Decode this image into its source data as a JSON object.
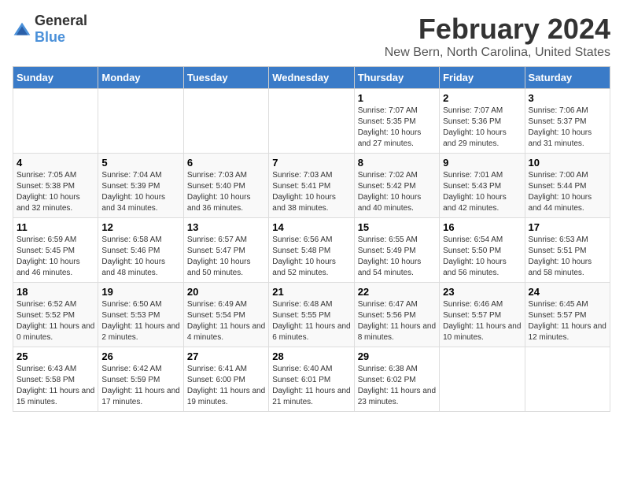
{
  "logo": {
    "text_general": "General",
    "text_blue": "Blue"
  },
  "header": {
    "title": "February 2024",
    "subtitle": "New Bern, North Carolina, United States"
  },
  "days_of_week": [
    "Sunday",
    "Monday",
    "Tuesday",
    "Wednesday",
    "Thursday",
    "Friday",
    "Saturday"
  ],
  "weeks": [
    {
      "days": [
        {
          "num": "",
          "sunrise": "",
          "sunset": "",
          "daylight": ""
        },
        {
          "num": "",
          "sunrise": "",
          "sunset": "",
          "daylight": ""
        },
        {
          "num": "",
          "sunrise": "",
          "sunset": "",
          "daylight": ""
        },
        {
          "num": "",
          "sunrise": "",
          "sunset": "",
          "daylight": ""
        },
        {
          "num": "1",
          "sunrise": "Sunrise: 7:07 AM",
          "sunset": "Sunset: 5:35 PM",
          "daylight": "Daylight: 10 hours and 27 minutes."
        },
        {
          "num": "2",
          "sunrise": "Sunrise: 7:07 AM",
          "sunset": "Sunset: 5:36 PM",
          "daylight": "Daylight: 10 hours and 29 minutes."
        },
        {
          "num": "3",
          "sunrise": "Sunrise: 7:06 AM",
          "sunset": "Sunset: 5:37 PM",
          "daylight": "Daylight: 10 hours and 31 minutes."
        }
      ]
    },
    {
      "days": [
        {
          "num": "4",
          "sunrise": "Sunrise: 7:05 AM",
          "sunset": "Sunset: 5:38 PM",
          "daylight": "Daylight: 10 hours and 32 minutes."
        },
        {
          "num": "5",
          "sunrise": "Sunrise: 7:04 AM",
          "sunset": "Sunset: 5:39 PM",
          "daylight": "Daylight: 10 hours and 34 minutes."
        },
        {
          "num": "6",
          "sunrise": "Sunrise: 7:03 AM",
          "sunset": "Sunset: 5:40 PM",
          "daylight": "Daylight: 10 hours and 36 minutes."
        },
        {
          "num": "7",
          "sunrise": "Sunrise: 7:03 AM",
          "sunset": "Sunset: 5:41 PM",
          "daylight": "Daylight: 10 hours and 38 minutes."
        },
        {
          "num": "8",
          "sunrise": "Sunrise: 7:02 AM",
          "sunset": "Sunset: 5:42 PM",
          "daylight": "Daylight: 10 hours and 40 minutes."
        },
        {
          "num": "9",
          "sunrise": "Sunrise: 7:01 AM",
          "sunset": "Sunset: 5:43 PM",
          "daylight": "Daylight: 10 hours and 42 minutes."
        },
        {
          "num": "10",
          "sunrise": "Sunrise: 7:00 AM",
          "sunset": "Sunset: 5:44 PM",
          "daylight": "Daylight: 10 hours and 44 minutes."
        }
      ]
    },
    {
      "days": [
        {
          "num": "11",
          "sunrise": "Sunrise: 6:59 AM",
          "sunset": "Sunset: 5:45 PM",
          "daylight": "Daylight: 10 hours and 46 minutes."
        },
        {
          "num": "12",
          "sunrise": "Sunrise: 6:58 AM",
          "sunset": "Sunset: 5:46 PM",
          "daylight": "Daylight: 10 hours and 48 minutes."
        },
        {
          "num": "13",
          "sunrise": "Sunrise: 6:57 AM",
          "sunset": "Sunset: 5:47 PM",
          "daylight": "Daylight: 10 hours and 50 minutes."
        },
        {
          "num": "14",
          "sunrise": "Sunrise: 6:56 AM",
          "sunset": "Sunset: 5:48 PM",
          "daylight": "Daylight: 10 hours and 52 minutes."
        },
        {
          "num": "15",
          "sunrise": "Sunrise: 6:55 AM",
          "sunset": "Sunset: 5:49 PM",
          "daylight": "Daylight: 10 hours and 54 minutes."
        },
        {
          "num": "16",
          "sunrise": "Sunrise: 6:54 AM",
          "sunset": "Sunset: 5:50 PM",
          "daylight": "Daylight: 10 hours and 56 minutes."
        },
        {
          "num": "17",
          "sunrise": "Sunrise: 6:53 AM",
          "sunset": "Sunset: 5:51 PM",
          "daylight": "Daylight: 10 hours and 58 minutes."
        }
      ]
    },
    {
      "days": [
        {
          "num": "18",
          "sunrise": "Sunrise: 6:52 AM",
          "sunset": "Sunset: 5:52 PM",
          "daylight": "Daylight: 11 hours and 0 minutes."
        },
        {
          "num": "19",
          "sunrise": "Sunrise: 6:50 AM",
          "sunset": "Sunset: 5:53 PM",
          "daylight": "Daylight: 11 hours and 2 minutes."
        },
        {
          "num": "20",
          "sunrise": "Sunrise: 6:49 AM",
          "sunset": "Sunset: 5:54 PM",
          "daylight": "Daylight: 11 hours and 4 minutes."
        },
        {
          "num": "21",
          "sunrise": "Sunrise: 6:48 AM",
          "sunset": "Sunset: 5:55 PM",
          "daylight": "Daylight: 11 hours and 6 minutes."
        },
        {
          "num": "22",
          "sunrise": "Sunrise: 6:47 AM",
          "sunset": "Sunset: 5:56 PM",
          "daylight": "Daylight: 11 hours and 8 minutes."
        },
        {
          "num": "23",
          "sunrise": "Sunrise: 6:46 AM",
          "sunset": "Sunset: 5:57 PM",
          "daylight": "Daylight: 11 hours and 10 minutes."
        },
        {
          "num": "24",
          "sunrise": "Sunrise: 6:45 AM",
          "sunset": "Sunset: 5:57 PM",
          "daylight": "Daylight: 11 hours and 12 minutes."
        }
      ]
    },
    {
      "days": [
        {
          "num": "25",
          "sunrise": "Sunrise: 6:43 AM",
          "sunset": "Sunset: 5:58 PM",
          "daylight": "Daylight: 11 hours and 15 minutes."
        },
        {
          "num": "26",
          "sunrise": "Sunrise: 6:42 AM",
          "sunset": "Sunset: 5:59 PM",
          "daylight": "Daylight: 11 hours and 17 minutes."
        },
        {
          "num": "27",
          "sunrise": "Sunrise: 6:41 AM",
          "sunset": "Sunset: 6:00 PM",
          "daylight": "Daylight: 11 hours and 19 minutes."
        },
        {
          "num": "28",
          "sunrise": "Sunrise: 6:40 AM",
          "sunset": "Sunset: 6:01 PM",
          "daylight": "Daylight: 11 hours and 21 minutes."
        },
        {
          "num": "29",
          "sunrise": "Sunrise: 6:38 AM",
          "sunset": "Sunset: 6:02 PM",
          "daylight": "Daylight: 11 hours and 23 minutes."
        },
        {
          "num": "",
          "sunrise": "",
          "sunset": "",
          "daylight": ""
        },
        {
          "num": "",
          "sunrise": "",
          "sunset": "",
          "daylight": ""
        }
      ]
    }
  ]
}
